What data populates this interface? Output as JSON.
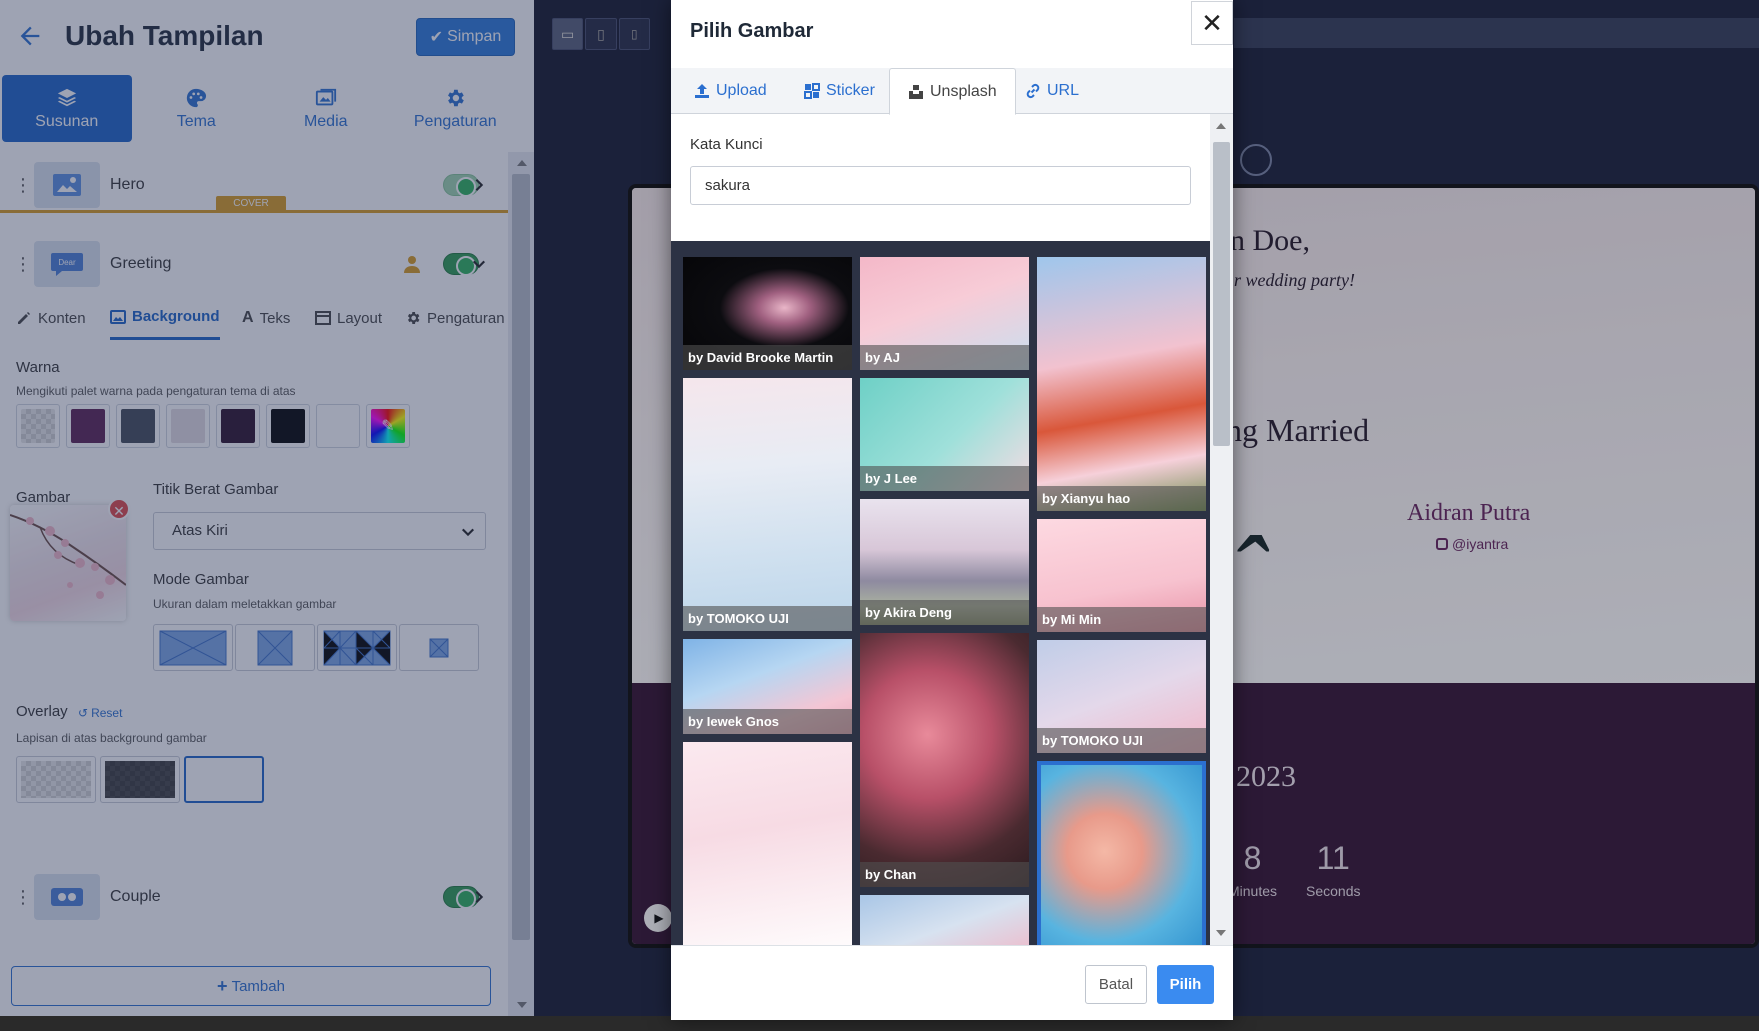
{
  "editor": {
    "title": "Ubah Tampilan",
    "save_label": "Simpan",
    "main_tabs": [
      {
        "label": "Susunan",
        "icon": "layers-icon",
        "active": true
      },
      {
        "label": "Tema",
        "icon": "palette-icon"
      },
      {
        "label": "Media",
        "icon": "images-icon"
      },
      {
        "label": "Pengaturan",
        "icon": "gear-icon"
      }
    ],
    "sections": [
      {
        "label": "Hero",
        "badge": "COVER",
        "enabled": true
      },
      {
        "label": "Greeting",
        "enabled": true,
        "expanded": true
      },
      {
        "label": "Couple",
        "enabled": true
      }
    ],
    "greeting_subtabs": [
      {
        "label": "Konten",
        "icon": "edit-icon"
      },
      {
        "label": "Background",
        "icon": "image-icon",
        "active": true
      },
      {
        "label": "Teks",
        "icon": "font-icon"
      },
      {
        "label": "Layout",
        "icon": "layout-icon"
      },
      {
        "label": "Pengaturan",
        "icon": "gear-icon"
      }
    ],
    "warna": {
      "label": "Warna",
      "hint": "Mengikuti palet warna pada pengaturan tema di atas",
      "swatches": [
        "transparent",
        "#5a1f50",
        "#424a56",
        "#e4dde2",
        "#2a0f28",
        "#000000",
        "#ffffff",
        "custom"
      ]
    },
    "gambar": {
      "label": "Gambar"
    },
    "titik_berat": {
      "label": "Titik Berat Gambar",
      "value": "Atas Kiri"
    },
    "mode_gambar": {
      "label": "Mode Gambar",
      "hint": "Ukuran dalam meletakkan gambar"
    },
    "overlay": {
      "label": "Overlay",
      "reset_label": "Reset",
      "hint": "Lapisan di atas background gambar"
    },
    "add_label": "Tambah"
  },
  "preview": {
    "line1": "n Doe,",
    "line2": "r wedding party!",
    "line3": "ng Married",
    "groom_name": "Aidran Putra",
    "groom_ig": "@iyantra",
    "year": "2023",
    "countdown": [
      {
        "value": "8",
        "label": "Minutes"
      },
      {
        "value": "11",
        "label": "Seconds"
      }
    ]
  },
  "modal": {
    "title": "Pilih Gambar",
    "tabs": [
      {
        "label": "Upload",
        "icon": "upload-icon"
      },
      {
        "label": "Sticker",
        "icon": "sticker-icon"
      },
      {
        "label": "Unsplash",
        "icon": "unsplash-icon",
        "active": true
      },
      {
        "label": "URL",
        "icon": "link-icon"
      }
    ],
    "keyword_label": "Kata Kunci",
    "keyword_value": "sakura",
    "photos": [
      {
        "caption": "by David Brooke Martin"
      },
      {
        "caption": "by AJ"
      },
      {
        "caption": "by Xianyu hao"
      },
      {
        "caption": "by TOMOKO UJI"
      },
      {
        "caption": "by J Lee"
      },
      {
        "caption": "by Akira Deng"
      },
      {
        "caption": "by Mi Min"
      },
      {
        "caption": "by Iewek Gnos"
      },
      {
        "caption": "by Chan"
      },
      {
        "caption": "by TOMOKO UJI"
      },
      {
        "caption": ""
      },
      {
        "caption": ""
      },
      {
        "caption": ""
      }
    ],
    "cancel_label": "Batal",
    "choose_label": "Pilih"
  }
}
